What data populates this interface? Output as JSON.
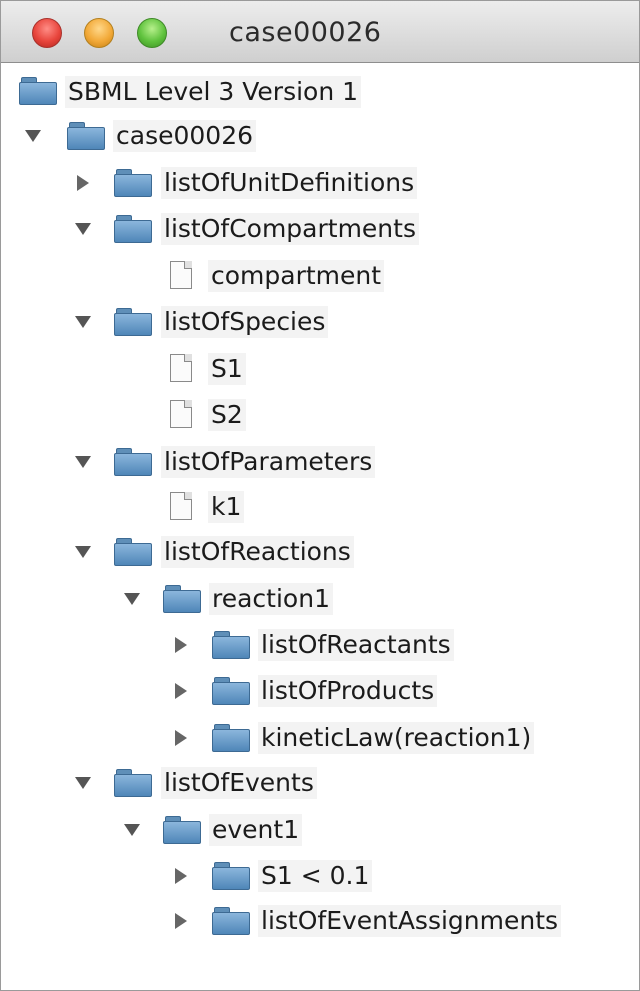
{
  "window": {
    "title": "case00026"
  },
  "tree": {
    "root": "SBML Level 3 Version 1",
    "items": [
      {
        "label": "case00026"
      },
      {
        "label": "listOfUnitDefinitions"
      },
      {
        "label": "listOfCompartments"
      },
      {
        "label": "compartment"
      },
      {
        "label": "listOfSpecies"
      },
      {
        "label": "S1"
      },
      {
        "label": "S2"
      },
      {
        "label": "listOfParameters"
      },
      {
        "label": "k1"
      },
      {
        "label": "listOfReactions"
      },
      {
        "label": "reaction1"
      },
      {
        "label": "listOfReactants"
      },
      {
        "label": "listOfProducts"
      },
      {
        "label": "kineticLaw(reaction1)"
      },
      {
        "label": "listOfEvents"
      },
      {
        "label": "event1"
      },
      {
        "label": "S1 < 0.1"
      },
      {
        "label": "listOfEventAssignments"
      }
    ]
  },
  "colors": {
    "folder": "#5f8fb8",
    "close": "#e8453c",
    "minimize": "#f2a938",
    "zoom": "#5fc23d"
  }
}
